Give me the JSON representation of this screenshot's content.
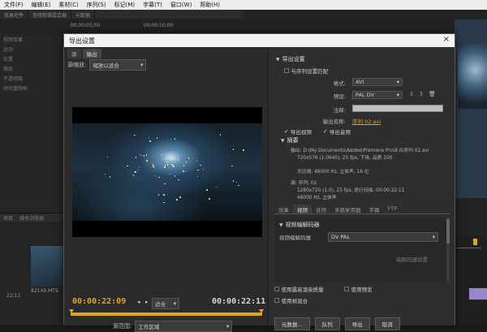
{
  "app": {
    "menu": [
      "文件(F)",
      "编辑(E)",
      "素材(C)",
      "序列(S)",
      "标记(M)",
      "字幕(T)",
      "窗口(W)",
      "帮助(H)"
    ],
    "tabs": [
      "效果控件",
      "音频剪辑混合器",
      "元数据"
    ],
    "timecodes": [
      "00;00;05;00",
      "00;00;10;00"
    ],
    "left_rows": [
      "视频效果",
      "运动",
      "位置",
      "缩放",
      "不透明度",
      "时间重映射"
    ],
    "bottom_tabs": [
      "项目",
      "媒体浏览器"
    ],
    "thumb_label": "82149.MTS",
    "thumb_duration": "22;11"
  },
  "dialog": {
    "title": "导出设置",
    "close": "×",
    "left": {
      "tabs": [
        "源",
        "输出"
      ],
      "source_scaling_label": "源缩放:",
      "source_scaling_value": "缩放以适合",
      "timecode_in": "00:00:22:09",
      "timecode_out": "00:00:22:11",
      "fit_value": "适合",
      "range_label": "源范围:",
      "range_value": "工作区域"
    },
    "right": {
      "export_settings_header": "导出设置",
      "match_sequence": "与序列设置匹配",
      "format_label": "格式:",
      "format_value": "AVI",
      "preset_label": "预设:",
      "preset_value": "PAL DV",
      "comment_label": "注释:",
      "output_name_label": "输出名称:",
      "output_name_value": "序列 02.avi",
      "export_video": "导出视频",
      "export_audio": "导出音频",
      "summary_header": "摘要",
      "summary_output": "输出: D:\\My Documents\\Adobe\\Premiere Pro\\8.0\\序列 02.avi",
      "summary_output_2": "720x576 (1.0940), 25 fps, 下场, 品质 100",
      "summary_audio": "无压缩, 48000 Hz, 立体声, 16 位",
      "summary_source": "源: 序列, 02",
      "summary_source_2": "1280x720 (1.0), 25 fps, 逐行扫描, 00:00:22:11",
      "summary_source_3": "48000 Hz, 立体声",
      "tabs": [
        "效果",
        "视频",
        "音频",
        "多路复用器",
        "字幕",
        "FTP"
      ],
      "active_tab": 1,
      "codec_header": "视频编解码器",
      "codec_label": "视频编解码器",
      "codec_value": "DV PAL",
      "codec_settings": "编解码器设置",
      "max_render": "使用最高渲染质量",
      "use_preview": "使用预览",
      "use_frame_blend": "使用帧混合",
      "btn_metadata": "元数据...",
      "btn_queue": "队列",
      "btn_export": "导出",
      "btn_cancel": "取消"
    }
  },
  "colors": {
    "accent": "#e8a21c",
    "dialog_bg": "#2e2e2e",
    "titlebar": "#f2f2f2"
  }
}
